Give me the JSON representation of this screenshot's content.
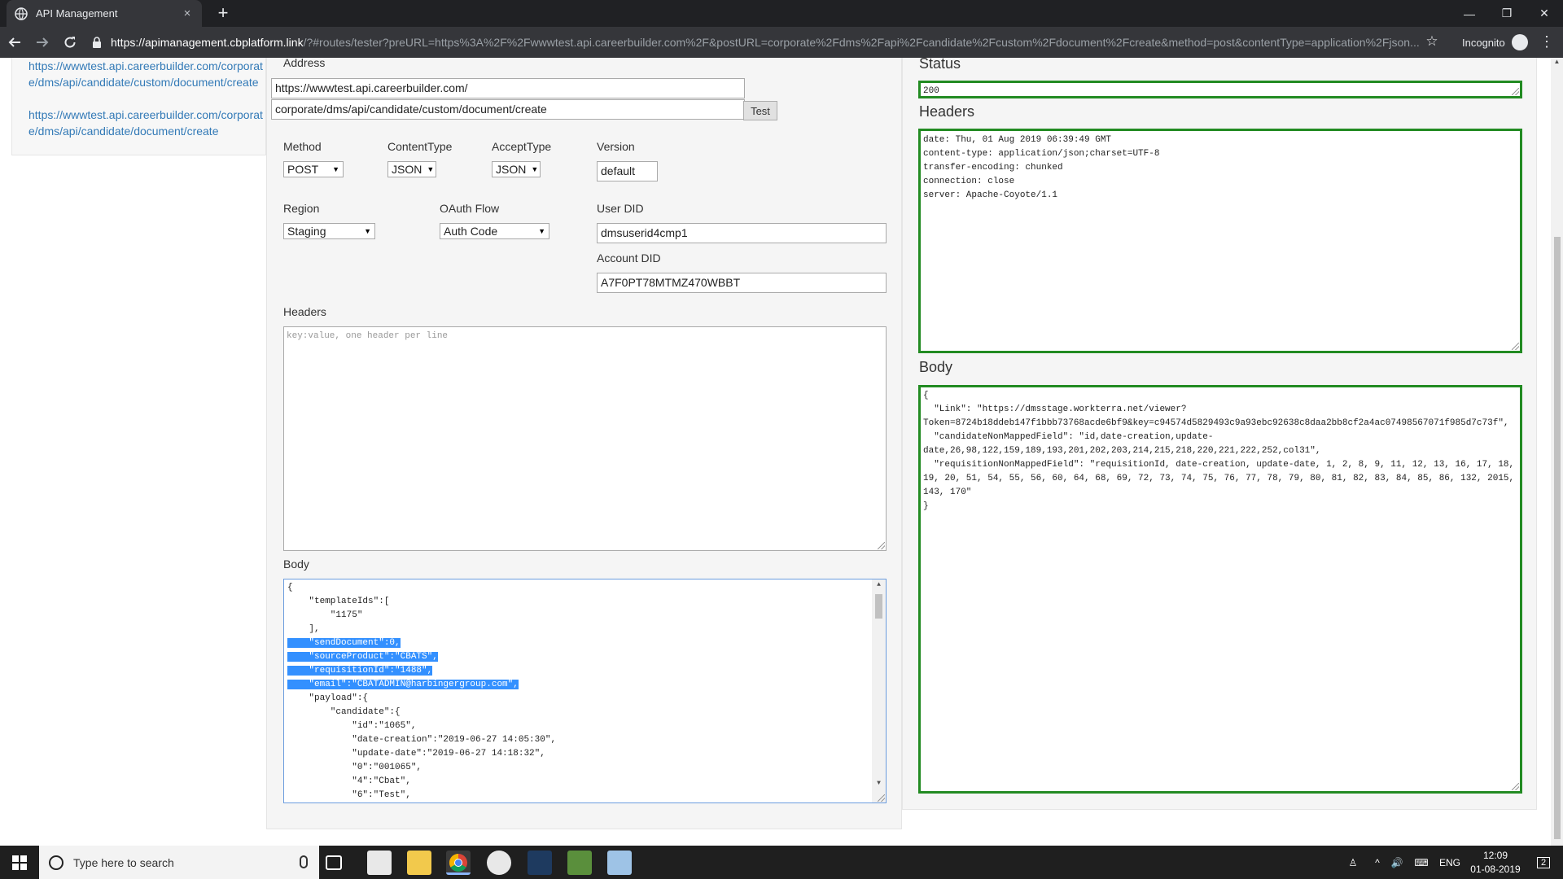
{
  "browser": {
    "tab_title": "API Management",
    "tab_close": "×",
    "new_tab": "+",
    "url_host": "https://apimanagement.cbplatform.link",
    "url_rest": "/?#routes/tester?preURL=https%3A%2F%2Fwwwtest.api.careerbuilder.com%2F&postURL=corporate%2Fdms%2Fapi%2Fcandidate%2Fcustom%2Fdocument%2Fcreate&method=post&contentType=application%2Fjson...",
    "incognito_label": "Incognito",
    "minimize": "—",
    "restore": "❐",
    "close": "✕"
  },
  "sidebar": {
    "links": [
      "https://wwwtest.api.careerbuilder.com/corporate/dms/api/candidate/custom/document/create",
      "https://wwwtest.api.careerbuilder.com/corporate/dms/api/candidate/document/create"
    ]
  },
  "request": {
    "address_label": "Address",
    "base_url": "https://wwwtest.api.careerbuilder.com/",
    "path_url": "corporate/dms/api/candidate/custom/document/create",
    "test_button": "Test",
    "method_label": "Method",
    "method_value": "POST",
    "content_type_label": "ContentType",
    "content_type_value": "JSON",
    "accept_type_label": "AcceptType",
    "accept_type_value": "JSON",
    "version_label": "Version",
    "version_value": "default",
    "region_label": "Region",
    "region_value": "Staging",
    "oauth_label": "OAuth Flow",
    "oauth_value": "Auth Code",
    "user_did_label": "User DID",
    "user_did_value": "dmsuserid4cmp1",
    "account_did_label": "Account DID",
    "account_did_value": "A7F0PT78MTMZ470WBBT",
    "headers_label": "Headers",
    "headers_placeholder": "key:value, one header per line",
    "body_label": "Body",
    "body_lines": [
      "{",
      "    \"templateIds\":[",
      "        \"1175\"",
      "    ],",
      "    \"sendDocument\":0,",
      "    \"sourceProduct\":\"CBATS\",",
      "    \"requisitionId\":\"1488\",",
      "    \"email\":\"CBATADMIN@harbingergroup.com\",",
      "    \"payload\":{",
      "        \"candidate\":{",
      "            \"id\":\"1065\",",
      "            \"date-creation\":\"2019-06-27 14:05:30\",",
      "            \"update-date\":\"2019-06-27 14:18:32\",",
      "            \"0\":\"001065\",",
      "            \"4\":\"Cbat\",",
      "            \"6\":\"Test\","
    ]
  },
  "response": {
    "status_label": "Status",
    "status_value": "200",
    "headers_label": "Headers",
    "header_lines": [
      "date: Thu, 01 Aug 2019 06:39:49 GMT",
      "content-type: application/json;charset=UTF-8",
      "transfer-encoding: chunked",
      "connection: close",
      "server: Apache-Coyote/1.1"
    ],
    "body_label": "Body",
    "body_lines": [
      "{",
      "  \"Link\": \"https://dmsstage.workterra.net/viewer?",
      "Token=8724b18ddeb147f1bbb73768acde6bf9&key=c94574d5829493c9a93ebc92638c8daa2bb8cf2a4ac07498567071f985d7c73f\",",
      "  \"candidateNonMappedField\": \"id,date-creation,update-",
      "date,26,98,122,159,189,193,201,202,203,214,215,218,220,221,222,252,col31\",",
      "  \"requisitionNonMappedField\": \"requisitionId, date-creation, update-date, 1, 2, 8, 9, 11, 12, 13, 16, 17, 18,",
      "19, 20, 51, 54, 55, 56, 60, 64, 68, 69, 72, 73, 74, 75, 76, 77, 78, 79, 80, 81, 82, 83, 84, 85, 86, 132, 2015,",
      "143, 170\"",
      "}"
    ]
  },
  "taskbar": {
    "search_placeholder": "Type here to search",
    "language": "ENG",
    "time": "12:09",
    "date": "01-08-2019",
    "notifications": "2"
  },
  "colors": {
    "chrome_dark": "#202124",
    "chrome_toolbar": "#35363a",
    "link": "#337ab7",
    "success_border": "#228b22",
    "selection": "#3390ff"
  }
}
